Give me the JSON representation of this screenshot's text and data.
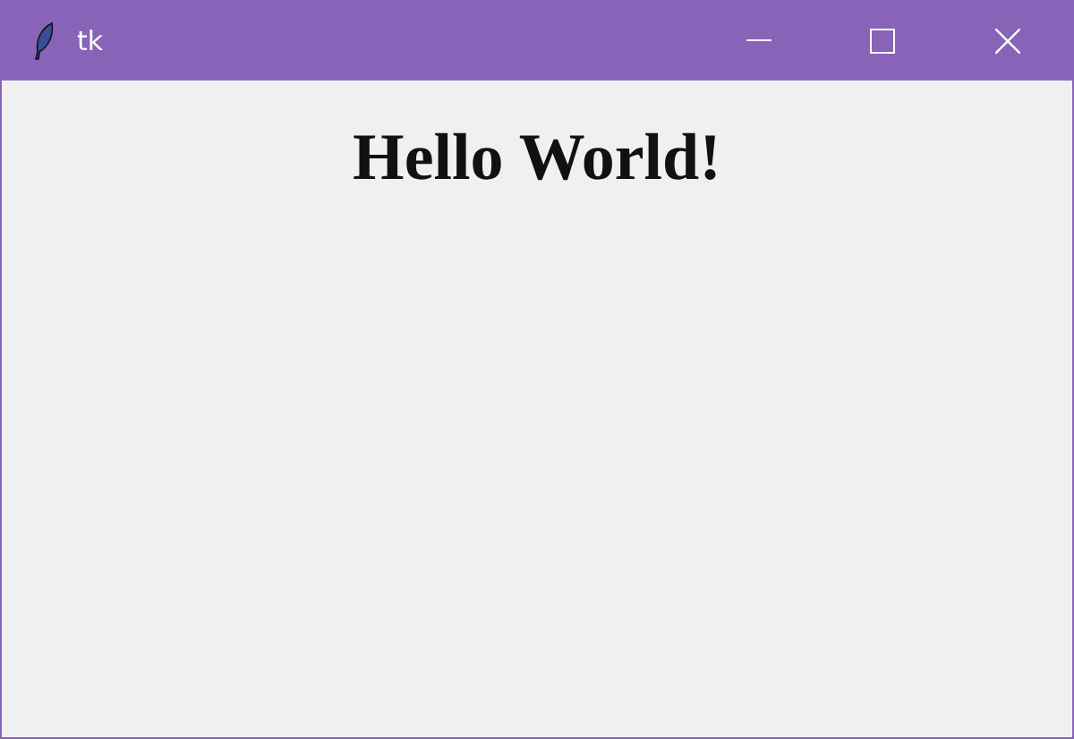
{
  "window": {
    "title": "tk"
  },
  "label": {
    "text": "Hello World!"
  }
}
